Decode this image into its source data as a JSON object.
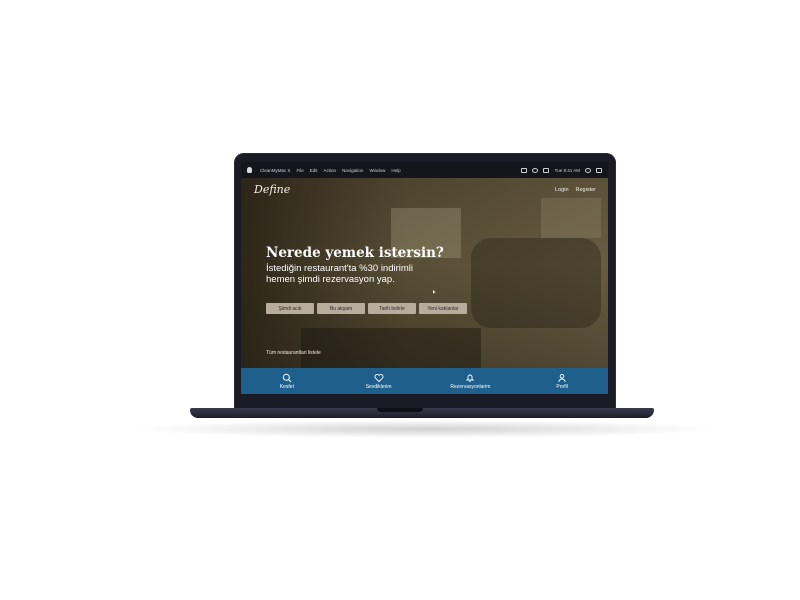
{
  "menubar": {
    "app": "CleanMyMac X",
    "items": [
      "File",
      "Edit",
      "Action",
      "Navigation",
      "Window",
      "Help"
    ],
    "time": "Tue 8:41 AM"
  },
  "site": {
    "logo": "Define",
    "nav": {
      "login": "Login",
      "register": "Register"
    }
  },
  "hero": {
    "title": "Nerede yemek istersin?",
    "subtitle": "İstediğin restaurant'ta %30 indirimli hemen şimdi rezervasyon yap."
  },
  "chips": [
    "Şimdi acık",
    "Bu akşam",
    "Tarih belirle",
    "Yeni katılanlar"
  ],
  "list_all": "Tüm restaurantlari listele",
  "tabbar": {
    "items": [
      {
        "label": "Kesfet",
        "icon": "search-icon"
      },
      {
        "label": "Sevdiklerim",
        "icon": "heart-icon"
      },
      {
        "label": "Rezervasyonlarim",
        "icon": "bell-icon"
      },
      {
        "label": "Profil",
        "icon": "user-icon"
      }
    ],
    "color": "#1f5f8b"
  }
}
